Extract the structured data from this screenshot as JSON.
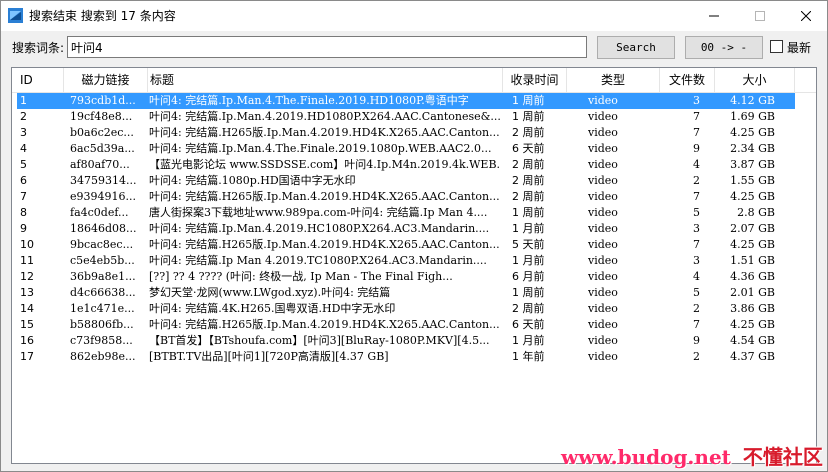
{
  "window": {
    "title": "搜索结束 搜索到 17 条内容",
    "icon": "app-icon"
  },
  "search": {
    "label": "搜索词条:",
    "value": "叶问4",
    "search_button": "Search",
    "page_button": "00 -> -",
    "latest_checkbox_label": "最新",
    "latest_checked": false
  },
  "columns": {
    "id": "ID",
    "magnet": "磁力链接",
    "title": "标题",
    "time": "收录时间",
    "type": "类型",
    "files": "文件数",
    "size": "大小"
  },
  "rows": [
    {
      "id": "1",
      "magnet": "793cdb1d...",
      "title": "叶问4: 完结篇.Ip.Man.4.The.Finale.2019.HD1080P.粤语中字",
      "time": "1 周前",
      "type": "video",
      "files": "3",
      "size": "4.12 GB"
    },
    {
      "id": "2",
      "magnet": "19cf48e8...",
      "title": "叶问4: 完结篇.Ip.Man.4.2019.HD1080P.X264.AAC.Cantonese&...",
      "time": "1 周前",
      "type": "video",
      "files": "7",
      "size": "1.69 GB"
    },
    {
      "id": "3",
      "magnet": "b0a6c2ec...",
      "title": "叶问4: 完结篇.H265版.Ip.Man.4.2019.HD4K.X265.AAC.Canton...",
      "time": "2 周前",
      "type": "video",
      "files": "7",
      "size": "4.25 GB"
    },
    {
      "id": "4",
      "magnet": "6ac5d39a...",
      "title": "叶问4: 完结篇.Ip.Man.4.The.Finale.2019.1080p.WEB.AAC2.0...",
      "time": "6 天前",
      "type": "video",
      "files": "9",
      "size": "2.34 GB"
    },
    {
      "id": "5",
      "magnet": "af80af70...",
      "title": "【蓝光电影论坛 www.SSDSSE.com】叶问4.Ip.M4n.2019.4k.WEB...",
      "time": "2 周前",
      "type": "video",
      "files": "4",
      "size": "3.87 GB"
    },
    {
      "id": "6",
      "magnet": "34759314...",
      "title": "叶问4: 完结篇.1080p.HD国语中字无水印",
      "time": "2 周前",
      "type": "video",
      "files": "2",
      "size": "1.55 GB"
    },
    {
      "id": "7",
      "magnet": "e9394916...",
      "title": "叶问4: 完结篇.H265版.Ip.Man.4.2019.HD4K.X265.AAC.Canton...",
      "time": "2 周前",
      "type": "video",
      "files": "7",
      "size": "4.25 GB"
    },
    {
      "id": "8",
      "magnet": "fa4c0def...",
      "title": "唐人街探案3下载地址www.989pa.com-叶问4: 完结篇.Ip Man 4....",
      "time": "1 周前",
      "type": "video",
      "files": "5",
      "size": "2.8 GB"
    },
    {
      "id": "9",
      "magnet": "18646d08...",
      "title": "叶问4: 完结篇.Ip.Man.4.2019.HC1080P.X264.AC3.Mandarin....",
      "time": "1 月前",
      "type": "video",
      "files": "3",
      "size": "2.07 GB"
    },
    {
      "id": "10",
      "magnet": "9bcac8ec...",
      "title": "叶问4: 完结篇.H265版.Ip.Man.4.2019.HD4K.X265.AAC.Canton...",
      "time": "5 天前",
      "type": "video",
      "files": "7",
      "size": "4.25 GB"
    },
    {
      "id": "11",
      "magnet": "c5e4eb5b...",
      "title": "叶问4: 完结篇.Ip Man 4.2019.TC1080P.X264.AC3.Mandarin....",
      "time": "1 月前",
      "type": "video",
      "files": "3",
      "size": "1.51 GB"
    },
    {
      "id": "12",
      "magnet": "36b9a8e1...",
      "title": "[??] ?? 4 ???? (叶问: 终极一战, Ip Man - The Final Figh...",
      "time": "6 月前",
      "type": "video",
      "files": "4",
      "size": "4.36 GB"
    },
    {
      "id": "13",
      "magnet": "d4c66638...",
      "title": "梦幻天堂·龙网(www.LWgod.xyz).叶问4: 完结篇",
      "time": "1 周前",
      "type": "video",
      "files": "5",
      "size": "2.01 GB"
    },
    {
      "id": "14",
      "magnet": "1e1c471e...",
      "title": "叶问4: 完结篇.4K.H265.国粤双语.HD中字无水印",
      "time": "2 周前",
      "type": "video",
      "files": "2",
      "size": "3.86 GB"
    },
    {
      "id": "15",
      "magnet": "b58806fb...",
      "title": "叶问4: 完结篇.H265版.Ip.Man.4.2019.HD4K.X265.AAC.Canton...",
      "time": "6 天前",
      "type": "video",
      "files": "7",
      "size": "4.25 GB"
    },
    {
      "id": "16",
      "magnet": "c73f9858...",
      "title": "【BT首发】【BTshoufa.com】[叶问3][BluRay-1080P.MKV][4.5...",
      "time": "1 月前",
      "type": "video",
      "files": "9",
      "size": "4.54 GB"
    },
    {
      "id": "17",
      "magnet": "862eb98e...",
      "title": "[BTBT.TV出品][叶问1][720P高清版][4.37 GB]",
      "time": "1 年前",
      "type": "video",
      "files": "2",
      "size": "4.37 GB"
    }
  ],
  "selected_row": 0,
  "watermark": {
    "url": "www.budog.net",
    "name": "不懂社区"
  },
  "colors": {
    "selection": "#3399ff",
    "watermark": "#ff2a6a"
  }
}
